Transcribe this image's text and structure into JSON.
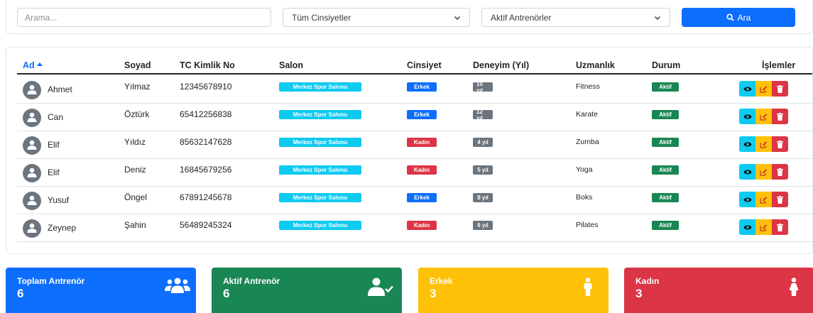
{
  "filters": {
    "search_placeholder": "Arama...",
    "gender_select": "Tüm Cinsiyetler",
    "status_select": "Aktif Antrenörler",
    "search_button": "Ara"
  },
  "table": {
    "headers": {
      "ad": "Ad",
      "soyad": "Soyad",
      "tc": "TC Kimlik No",
      "salon": "Salon",
      "cinsiyet": "Cinsiyet",
      "deneyim": "Deneyim (Yıl)",
      "uzmanlik": "Uzmanlık",
      "durum": "Durum",
      "islemler": "İşlemler"
    },
    "rows": [
      {
        "ad": "Ahmet",
        "soyad": "Yılmaz",
        "tc": "12345678910",
        "salon": "Merkez Spor Salonu",
        "cinsiyet": "Erkek",
        "deneyim": "10 yıl",
        "uzmanlik": "Fitness",
        "durum": "Aktif"
      },
      {
        "ad": "Can",
        "soyad": "Öztürk",
        "tc": "65412256838",
        "salon": "Merkez Spor Salonu",
        "cinsiyet": "Erkek",
        "deneyim": "12 yıl",
        "uzmanlik": "Karate",
        "durum": "Aktif"
      },
      {
        "ad": "Elif",
        "soyad": "Yıldız",
        "tc": "85632147628",
        "salon": "Merkez Spor Salonu",
        "cinsiyet": "Kadın",
        "deneyim": "4 yıl",
        "uzmanlik": "Zumba",
        "durum": "Aktif"
      },
      {
        "ad": "Elif",
        "soyad": "Deniz",
        "tc": "16845679256",
        "salon": "Merkez Spor Salonu",
        "cinsiyet": "Kadın",
        "deneyim": "5 yıl",
        "uzmanlik": "Yoga",
        "durum": "Aktif"
      },
      {
        "ad": "Yusuf",
        "soyad": "Öngel",
        "tc": "67891245678",
        "salon": "Merkez Spor Salonu",
        "cinsiyet": "Erkek",
        "deneyim": "8 yıl",
        "uzmanlik": "Boks",
        "durum": "Aktif"
      },
      {
        "ad": "Zeynep",
        "soyad": "Şahin",
        "tc": "56489245324",
        "salon": "Merkez Spor Salonu",
        "cinsiyet": "Kadın",
        "deneyim": "6 yıl",
        "uzmanlik": "Pilates",
        "durum": "Aktif"
      }
    ]
  },
  "stats": [
    {
      "label": "Toplam Antrenör",
      "value": "6",
      "color": "#0d6efd",
      "icon": "users-icon"
    },
    {
      "label": "Aktif Antrenör",
      "value": "6",
      "color": "#198754",
      "icon": "user-check-icon"
    },
    {
      "label": "Erkek",
      "value": "3",
      "color": "#ffc107",
      "icon": "male-icon"
    },
    {
      "label": "Kadın",
      "value": "3",
      "color": "#dc3545",
      "icon": "female-icon"
    }
  ],
  "colors": {
    "primary": "#0d6efd",
    "info": "#0dcaf0",
    "success": "#198754",
    "warning": "#ffc107",
    "danger": "#dc3545",
    "secondary": "#6c757d"
  }
}
